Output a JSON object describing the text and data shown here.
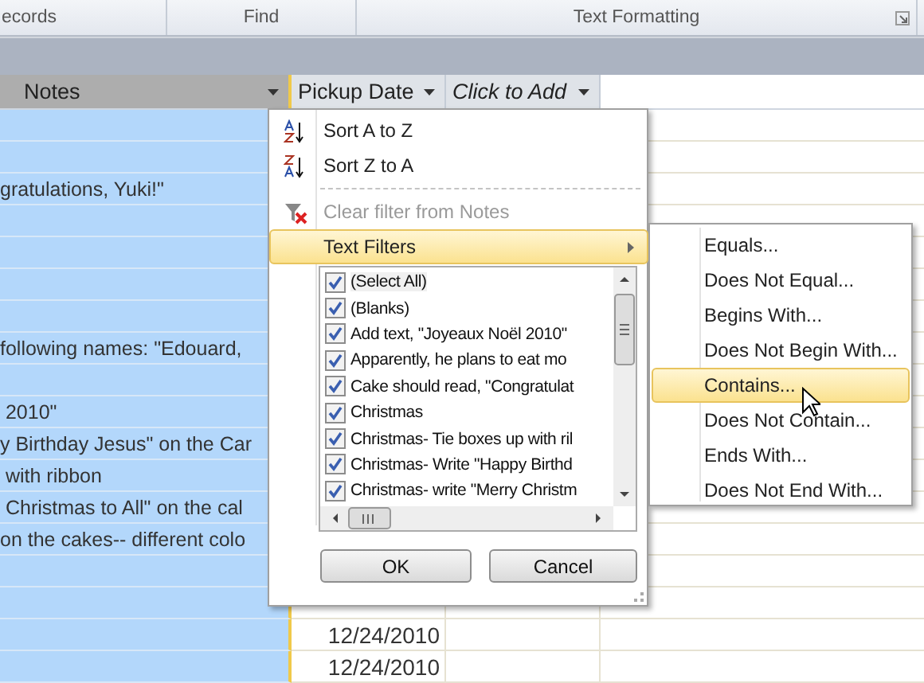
{
  "ribbon_groups": [
    {
      "label": "ecords"
    },
    {
      "label": "Find"
    },
    {
      "label": "Text Formatting"
    }
  ],
  "table": {
    "columns": [
      {
        "label": "Notes",
        "selected": true
      },
      {
        "label": "Pickup Date",
        "selected": false
      },
      {
        "label": "Click to Add",
        "selected": false
      }
    ],
    "rows": [
      {},
      {},
      {
        "notes": "gratulations, Yuki!\""
      },
      {},
      {},
      {},
      {},
      {
        "notes": "following names: \"Edouard,"
      },
      {},
      {
        "notes": " 2010\""
      },
      {
        "notes": "y Birthday Jesus\" on the Car"
      },
      {
        "notes": " with ribbon"
      },
      {
        "notes": " Christmas to All\" on the cal"
      },
      {
        "notes": "on the cakes-- different colo"
      },
      {},
      {},
      {
        "pickup_date": "12/24/2010"
      },
      {
        "pickup_date": "12/24/2010"
      }
    ]
  },
  "filter_menu": {
    "items": [
      {
        "kind": "sort_az",
        "label": "Sort A to Z",
        "disabled": false,
        "selected": false
      },
      {
        "kind": "sort_za",
        "label": "Sort Z to A",
        "disabled": false,
        "selected": false
      },
      {
        "kind": "clear",
        "label": "Clear filter from Notes",
        "disabled": true,
        "selected": false
      },
      {
        "kind": "submenu",
        "label": "Text Filters",
        "disabled": false,
        "selected": true
      }
    ],
    "values": [
      {
        "label": "(Select All)",
        "checked": true
      },
      {
        "label": "(Blanks)",
        "checked": true
      },
      {
        "label": "Add text, \"Joyeaux Noël 2010\"",
        "checked": true
      },
      {
        "label": "Apparently, he plans to eat mo",
        "checked": true
      },
      {
        "label": "Cake should read, \"Congratulat",
        "checked": true
      },
      {
        "label": "Christmas",
        "checked": true
      },
      {
        "label": "Christmas- Tie boxes up with ril",
        "checked": true
      },
      {
        "label": "Christmas- Write \"Happy Birthd",
        "checked": true
      },
      {
        "label": "Christmas- write \"Merry Christm",
        "checked": true
      }
    ],
    "buttons": [
      "OK",
      "Cancel"
    ]
  },
  "text_filters": [
    {
      "label": "Equals...",
      "selected": false
    },
    {
      "label": "Does Not Equal...",
      "selected": false
    },
    {
      "label": "Begins With...",
      "selected": false
    },
    {
      "label": "Does Not Begin With...",
      "selected": false
    },
    {
      "label": "Contains...",
      "selected": true
    },
    {
      "label": "Does Not Contain...",
      "selected": false
    },
    {
      "label": "Ends With...",
      "selected": false
    },
    {
      "label": "Does Not End With...",
      "selected": false
    }
  ]
}
